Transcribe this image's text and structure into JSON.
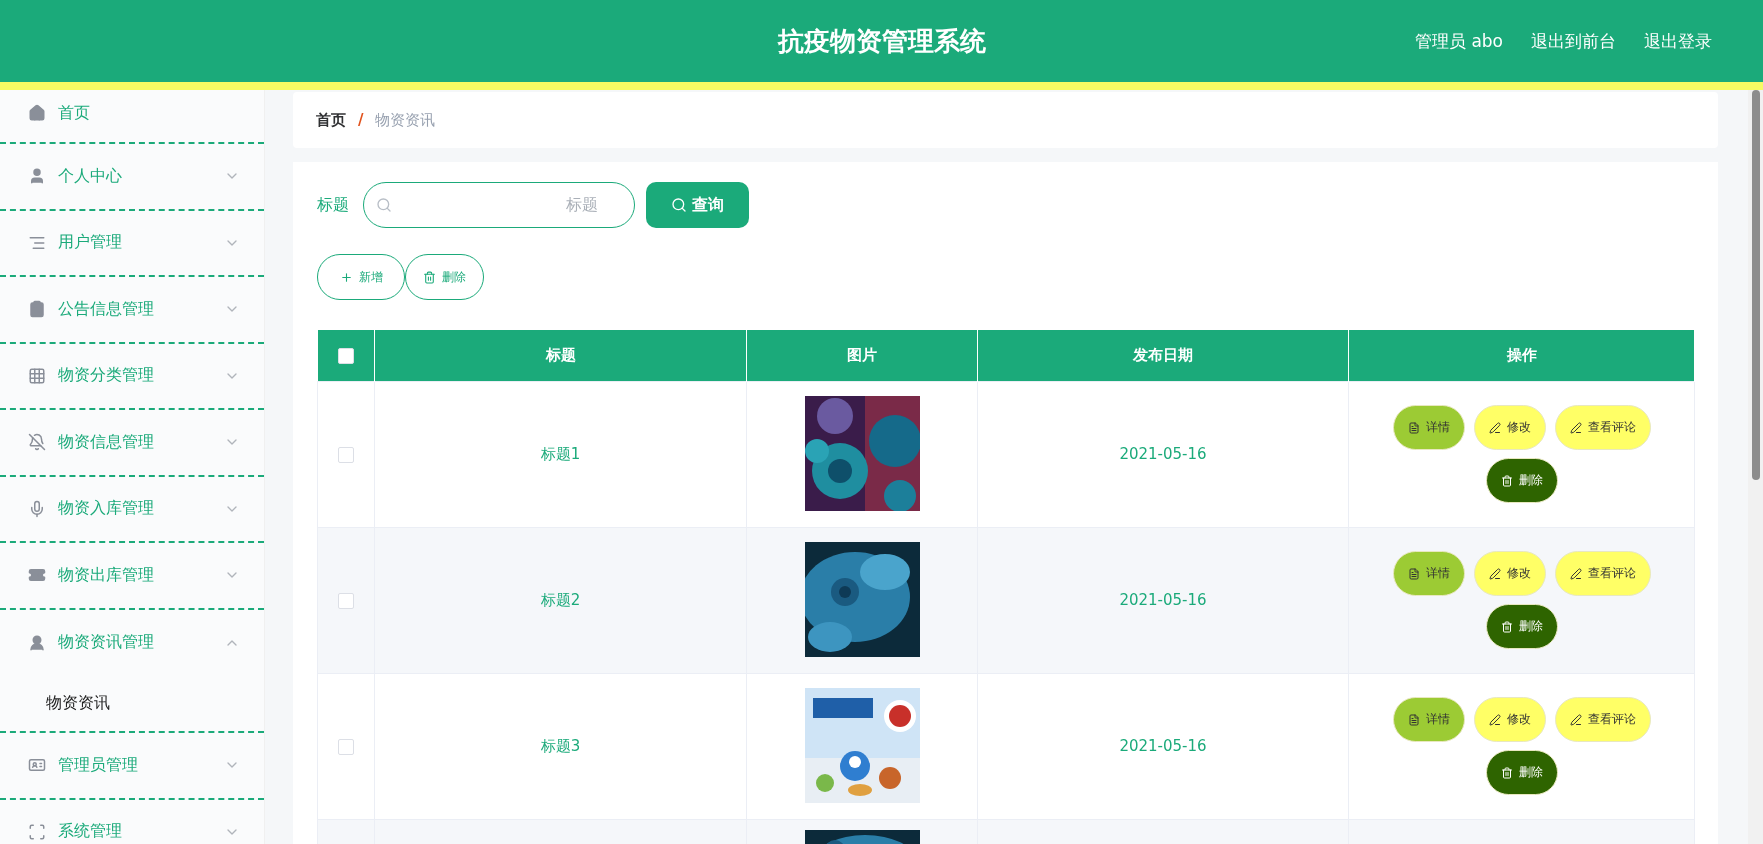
{
  "header": {
    "title": "抗疫物资管理系统",
    "links": [
      "管理员 abo",
      "退出到前台",
      "退出登录"
    ]
  },
  "sidebar": {
    "items": [
      {
        "label": "首页"
      },
      {
        "label": "个人中心",
        "expanded": false
      },
      {
        "label": "用户管理",
        "expanded": false
      },
      {
        "label": "公告信息管理",
        "expanded": false
      },
      {
        "label": "物资分类管理",
        "expanded": false
      },
      {
        "label": "物资信息管理",
        "expanded": false
      },
      {
        "label": "物资入库管理",
        "expanded": false
      },
      {
        "label": "物资出库管理",
        "expanded": false
      },
      {
        "label": "物资资讯管理",
        "expanded": true,
        "children": [
          {
            "label": "物资资讯"
          }
        ]
      },
      {
        "label": "管理员管理",
        "expanded": false
      },
      {
        "label": "系统管理",
        "expanded": false
      }
    ]
  },
  "breadcrumb": [
    "首页",
    "/",
    "物资资讯"
  ],
  "search": {
    "label": "标题",
    "placeholder": "标题",
    "button": "查询"
  },
  "toolbar": [
    {
      "label": "新增",
      "kind": "add"
    },
    {
      "label": "删除",
      "kind": "delete"
    }
  ],
  "table": {
    "select_all_checked": false,
    "columns": [
      "标题",
      "图片",
      "发布日期",
      "操作"
    ],
    "rows": [
      {
        "checked": false,
        "title": "标题1",
        "image": {
          "kind": "picture"
        },
        "date": "2021-05-16",
        "actions": [
          {
            "label": "详情",
            "kind": "detail"
          },
          {
            "label": "修改",
            "kind": "edit"
          },
          {
            "label": "查看评论",
            "kind": "comments"
          },
          {
            "label": "删除",
            "kind": "delete"
          }
        ]
      },
      {
        "checked": false,
        "title": "标题2",
        "image": {
          "kind": "picture"
        },
        "date": "2021-05-16",
        "actions": [
          {
            "label": "详情",
            "kind": "detail"
          },
          {
            "label": "修改",
            "kind": "edit"
          },
          {
            "label": "查看评论",
            "kind": "comments"
          },
          {
            "label": "删除",
            "kind": "delete"
          }
        ]
      },
      {
        "checked": false,
        "title": "标题3",
        "image": {
          "kind": "picture"
        },
        "date": "2021-05-16",
        "actions": [
          {
            "label": "详情",
            "kind": "detail"
          },
          {
            "label": "修改",
            "kind": "edit"
          },
          {
            "label": "查看评论",
            "kind": "comments"
          },
          {
            "label": "删除",
            "kind": "delete"
          }
        ]
      },
      {
        "image": {
          "kind": "picture"
        }
      }
    ]
  }
}
